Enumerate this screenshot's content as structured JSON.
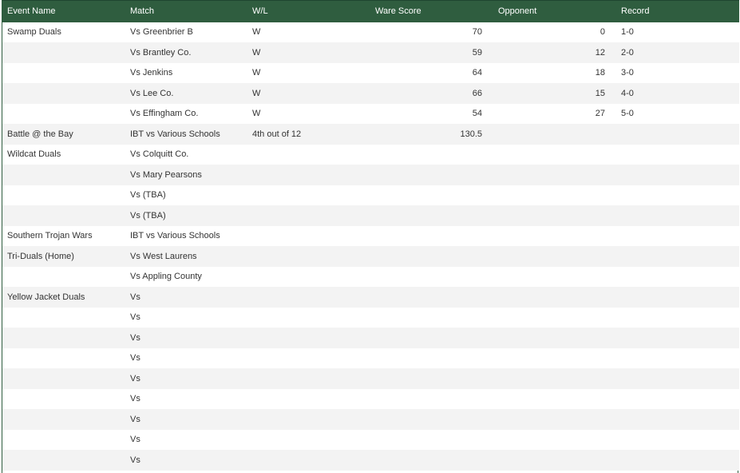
{
  "headers": [
    "Event Name",
    "Match",
    "W/L",
    "Ware Score",
    "Opponent",
    "Record"
  ],
  "rows": [
    [
      "Swamp Duals",
      "Vs Greenbrier B",
      "W",
      "70",
      "0",
      "1-0"
    ],
    [
      "",
      "Vs Brantley Co.",
      "W",
      "59",
      "12",
      "2-0"
    ],
    [
      "",
      "Vs Jenkins",
      "W",
      "64",
      "18",
      "3-0"
    ],
    [
      "",
      "Vs Lee Co.",
      "W",
      "66",
      "15",
      "4-0"
    ],
    [
      "",
      "Vs Effingham Co.",
      "W",
      "54",
      "27",
      "5-0"
    ],
    [
      "Battle @ the Bay",
      "IBT vs Various Schools",
      "4th out of 12",
      "130.5",
      "",
      ""
    ],
    [
      "Wildcat Duals",
      "Vs Colquitt Co.",
      "",
      "",
      "",
      ""
    ],
    [
      "",
      "Vs Mary Pearsons",
      "",
      "",
      "",
      ""
    ],
    [
      "",
      "Vs (TBA)",
      "",
      "",
      "",
      ""
    ],
    [
      "",
      "Vs (TBA)",
      "",
      "",
      "",
      ""
    ],
    [
      "Southern Trojan Wars",
      "IBT vs Various Schools",
      "",
      "",
      "",
      ""
    ],
    [
      "Tri-Duals (Home)",
      "Vs West Laurens",
      "",
      "",
      "",
      ""
    ],
    [
      "",
      "Vs Appling County",
      "",
      "",
      "",
      ""
    ],
    [
      "Yellow Jacket Duals",
      "Vs",
      "",
      "",
      "",
      ""
    ],
    [
      "",
      "Vs",
      "",
      "",
      "",
      ""
    ],
    [
      "",
      "Vs",
      "",
      "",
      "",
      ""
    ],
    [
      "",
      "Vs",
      "",
      "",
      "",
      ""
    ],
    [
      "",
      "Vs",
      "",
      "",
      "",
      ""
    ],
    [
      "",
      "Vs",
      "",
      "",
      "",
      ""
    ],
    [
      "",
      "Vs",
      "",
      "",
      "",
      ""
    ],
    [
      "",
      "Vs",
      "",
      "",
      "",
      ""
    ],
    [
      "",
      "Vs",
      "",
      "",
      "",
      ""
    ]
  ],
  "colors": {
    "header_bg": "#2f5d3f",
    "header_text": "#ffffff",
    "row_alt_bg": "#f3f3f3"
  }
}
